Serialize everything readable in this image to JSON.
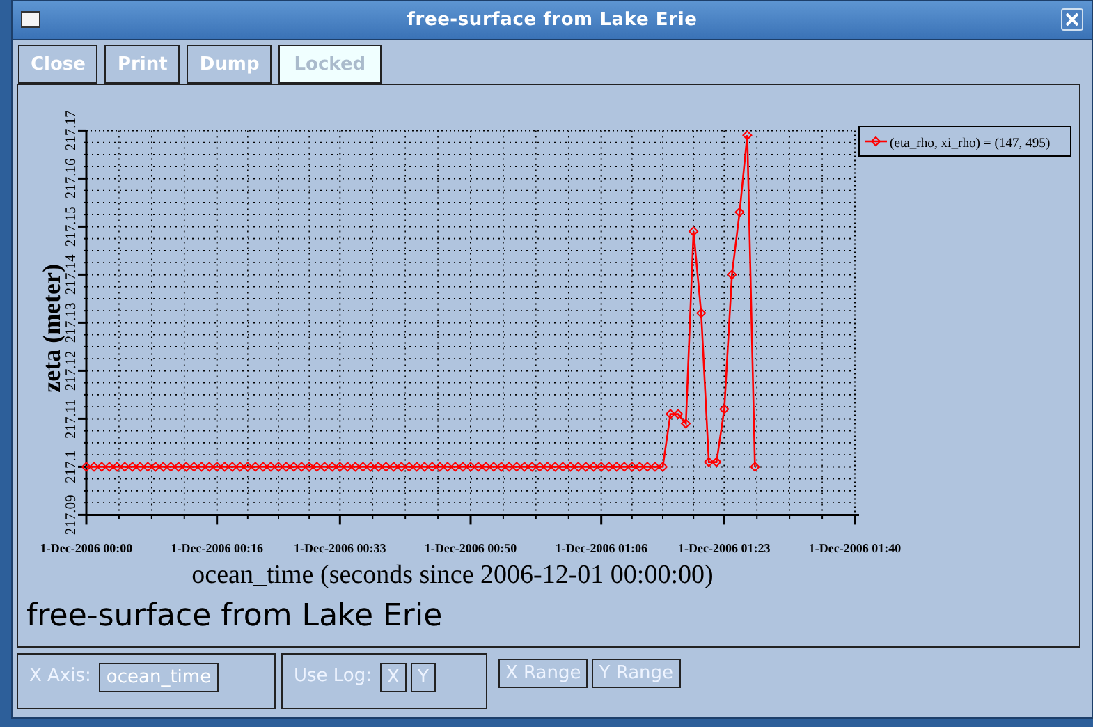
{
  "window": {
    "title": "free-surface from Lake Erie"
  },
  "toolbar": [
    {
      "label": "Close",
      "kind": "button"
    },
    {
      "label": "Print",
      "kind": "button"
    },
    {
      "label": "Dump",
      "kind": "button"
    },
    {
      "label": "Locked",
      "kind": "toggle",
      "on": true
    }
  ],
  "plot": {
    "chart_data": {
      "type": "line",
      "xlabel": "ocean_time (seconds since 2006-12-01 00:00:00)",
      "ylabel": "zeta (meter)",
      "categories": [
        "1-Dec-2006 00:00",
        null,
        null,
        null,
        null,
        null,
        null,
        null,
        null,
        null,
        null,
        null,
        null,
        null,
        null,
        null,
        null,
        "1-Dec-2006 00:16",
        null,
        null,
        null,
        null,
        null,
        null,
        null,
        null,
        null,
        null,
        null,
        null,
        null,
        null,
        null,
        "1-Dec-2006 00:33",
        null,
        null,
        null,
        null,
        null,
        null,
        null,
        null,
        null,
        null,
        null,
        null,
        null,
        null,
        null,
        null,
        "1-Dec-2006 00:50",
        null,
        null,
        null,
        null,
        null,
        null,
        null,
        null,
        null,
        null,
        null,
        null,
        null,
        null,
        null,
        null,
        "1-Dec-2006 01:06",
        null,
        null,
        null,
        null,
        null,
        null,
        null,
        null,
        null,
        null,
        null,
        null,
        null,
        null,
        null,
        "1-Dec-2006 01:23",
        null,
        null,
        null,
        null,
        null,
        null,
        null,
        null,
        null,
        null,
        null,
        null,
        null,
        null,
        null,
        null,
        "1-Dec-2006 01:40"
      ],
      "series": [
        {
          "name": "(eta_rho, xi_rho) = (147, 495)",
          "color": "#ff0000",
          "marker": "diamond",
          "values": [
            217.1,
            217.1,
            217.1,
            217.1,
            217.1,
            217.1,
            217.1,
            217.1,
            217.1,
            217.1,
            217.1,
            217.1,
            217.1,
            217.1,
            217.1,
            217.1,
            217.1,
            217.1,
            217.1,
            217.1,
            217.1,
            217.1,
            217.1,
            217.1,
            217.1,
            217.1,
            217.1,
            217.1,
            217.1,
            217.1,
            217.1,
            217.1,
            217.1,
            217.1,
            217.1,
            217.1,
            217.1,
            217.1,
            217.1,
            217.1,
            217.1,
            217.1,
            217.1,
            217.1,
            217.1,
            217.1,
            217.1,
            217.1,
            217.1,
            217.1,
            217.1,
            217.1,
            217.1,
            217.1,
            217.1,
            217.1,
            217.1,
            217.1,
            217.1,
            217.1,
            217.1,
            217.1,
            217.1,
            217.1,
            217.1,
            217.1,
            217.1,
            217.1,
            217.1,
            217.1,
            217.1,
            217.1,
            217.1,
            217.1,
            217.1,
            217.1,
            217.111,
            217.111,
            217.109,
            217.149,
            217.132,
            217.101,
            217.101,
            217.112,
            217.14,
            217.153,
            217.169,
            217.1,
            null,
            null,
            null,
            null,
            null,
            null,
            null,
            null,
            null,
            null,
            null,
            null,
            null
          ]
        }
      ],
      "grid": true,
      "ylim": [
        217.09,
        217.17
      ],
      "yticks": [
        217.09,
        217.1,
        217.11,
        217.12,
        217.13,
        217.14,
        217.15,
        217.16,
        217.17
      ]
    },
    "caption": "free-surface from Lake Erie"
  },
  "controls": {
    "x_axis": {
      "label": "X Axis:",
      "value": "ocean_time"
    },
    "use_log": {
      "label": "Use Log:",
      "buttons": [
        "X",
        "Y"
      ]
    },
    "range_buttons": [
      "X Range",
      "Y Range"
    ]
  }
}
